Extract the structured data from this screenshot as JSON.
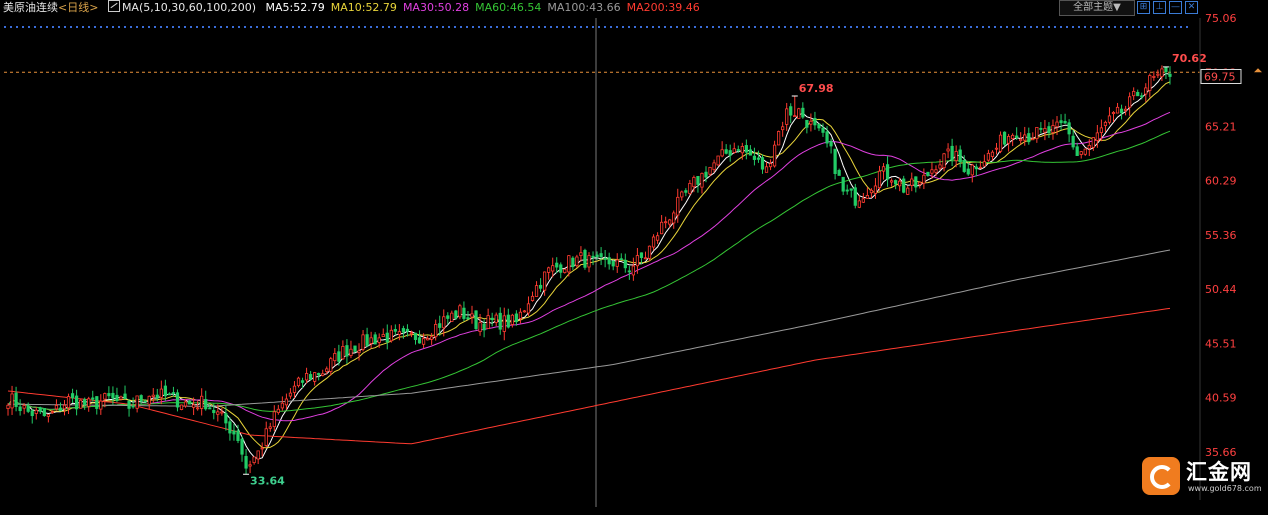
{
  "header": {
    "instrument": "美原油连续",
    "period": "<日线>",
    "ma_params": "MA(5,10,30,60,100,200)",
    "ma_values": [
      {
        "label": "MA5:52.79",
        "color": "#ffffff"
      },
      {
        "label": "MA10:52.79",
        "color": "#e8d43a"
      },
      {
        "label": "MA30:50.28",
        "color": "#e040e0"
      },
      {
        "label": "MA60:46.54",
        "color": "#35c535"
      },
      {
        "label": "MA100:43.66",
        "color": "#9a9a9a"
      },
      {
        "label": "MA200:39.46",
        "color": "#ff3b30"
      }
    ]
  },
  "toolbar": {
    "theme_select": "全部主题▼",
    "buttons": [
      {
        "name": "crosshair-toggle-button",
        "icon": "crosshair-icon",
        "glyph": "⊞"
      },
      {
        "name": "indicator-button",
        "icon": "indicator-icon",
        "glyph": "⊥"
      },
      {
        "name": "minimize-button",
        "icon": "minimize-icon",
        "glyph": "—"
      },
      {
        "name": "close-button",
        "icon": "close-icon",
        "glyph": "✕"
      }
    ]
  },
  "watermark": {
    "name": "汇金网",
    "url": "www.gold678.com"
  },
  "chart_data": {
    "type": "candlestick",
    "y_axis": {
      "min": 35.66,
      "max": 75.06,
      "ticks": [
        75.06,
        70.13,
        65.21,
        60.29,
        55.36,
        50.44,
        45.51,
        40.59,
        35.66
      ],
      "position": "right"
    },
    "current_price_line": 70.13,
    "current_price_tag": 69.75,
    "annotations": {
      "high_label": "70.62",
      "high_value": 70.62,
      "mid_high_label": "67.98",
      "mid_high_value": 67.98,
      "low_label": "33.64",
      "low_value": 33.64
    },
    "colors": {
      "up": "#ff3b30",
      "down": "#22cc66",
      "axis_text": "#ff4040",
      "dotted_grid": "#3a6dd8",
      "crosshair": "#777777"
    },
    "keypoints": [
      [
        0,
        40.6
      ],
      [
        5,
        39.3
      ],
      [
        10,
        38.8
      ],
      [
        15,
        40.4
      ],
      [
        20,
        39.9
      ],
      [
        25,
        40.5
      ],
      [
        30,
        39.8
      ],
      [
        35,
        41.0
      ],
      [
        40,
        40.6
      ],
      [
        45,
        40.0
      ],
      [
        49,
        40.2
      ],
      [
        53,
        38.7
      ],
      [
        57,
        37.0
      ],
      [
        59,
        34.3
      ],
      [
        62,
        35.6
      ],
      [
        66,
        38.8
      ],
      [
        70,
        41.0
      ],
      [
        74,
        42.5
      ],
      [
        78,
        43.0
      ],
      [
        83,
        44.8
      ],
      [
        88,
        45.6
      ],
      [
        93,
        46.2
      ],
      [
        98,
        46.0
      ],
      [
        103,
        46.3
      ],
      [
        108,
        47.6
      ],
      [
        112,
        48.4
      ],
      [
        116,
        47.4
      ],
      [
        121,
        47.5
      ],
      [
        126,
        47.4
      ],
      [
        130,
        50.2
      ],
      [
        134,
        52.1
      ],
      [
        138,
        52.8
      ],
      [
        142,
        53.2
      ],
      [
        146,
        52.7
      ],
      [
        150,
        52.9
      ],
      [
        154,
        52.4
      ],
      [
        158,
        53.5
      ],
      [
        162,
        56.2
      ],
      [
        166,
        58.1
      ],
      [
        170,
        60.0
      ],
      [
        174,
        61.5
      ],
      [
        178,
        62.8
      ],
      [
        181,
        63.5
      ],
      [
        185,
        62.2
      ],
      [
        188,
        61.2
      ],
      [
        190,
        63.8
      ],
      [
        193,
        66.5
      ],
      [
        196,
        66.6
      ],
      [
        199,
        65.3
      ],
      [
        202,
        64.1
      ],
      [
        204,
        62.8
      ],
      [
        207,
        59.2
      ],
      [
        210,
        58.7
      ],
      [
        213,
        59.5
      ],
      [
        216,
        61.0
      ],
      [
        219,
        60.8
      ],
      [
        222,
        59.6
      ],
      [
        226,
        59.9
      ],
      [
        230,
        61.9
      ],
      [
        234,
        62.7
      ],
      [
        238,
        61.3
      ],
      [
        241,
        62.1
      ],
      [
        244,
        62.8
      ],
      [
        247,
        64.2
      ],
      [
        250,
        64.9
      ],
      [
        253,
        64.4
      ],
      [
        256,
        64.6
      ],
      [
        259,
        64.8
      ],
      [
        262,
        65.3
      ],
      [
        265,
        62.7
      ],
      [
        268,
        63.4
      ],
      [
        271,
        64.9
      ],
      [
        274,
        66.0
      ],
      [
        277,
        66.8
      ],
      [
        280,
        68.2
      ],
      [
        283,
        69.3
      ],
      [
        286,
        69.8
      ],
      [
        288,
        69.75
      ]
    ],
    "candle_count": 289,
    "ma_periods": [
      5,
      10,
      30,
      60,
      100,
      200
    ],
    "ma_colors": [
      "#ffffff",
      "#e8d43a",
      "#e040e0",
      "#35c535",
      "#9a9a9a",
      "#ff3b30"
    ],
    "long_ma_curves": {
      "ma100": [
        [
          0,
          40.0
        ],
        [
          50,
          39.8
        ],
        [
          100,
          41.0
        ],
        [
          150,
          43.6
        ],
        [
          200,
          47.3
        ],
        [
          250,
          51.3
        ],
        [
          288,
          54.0
        ]
      ],
      "ma200": [
        [
          0,
          41.2
        ],
        [
          30,
          40.0
        ],
        [
          60,
          37.2
        ],
        [
          100,
          36.4
        ],
        [
          150,
          40.2
        ],
        [
          200,
          44.0
        ],
        [
          250,
          46.7
        ],
        [
          288,
          48.7
        ]
      ]
    }
  }
}
